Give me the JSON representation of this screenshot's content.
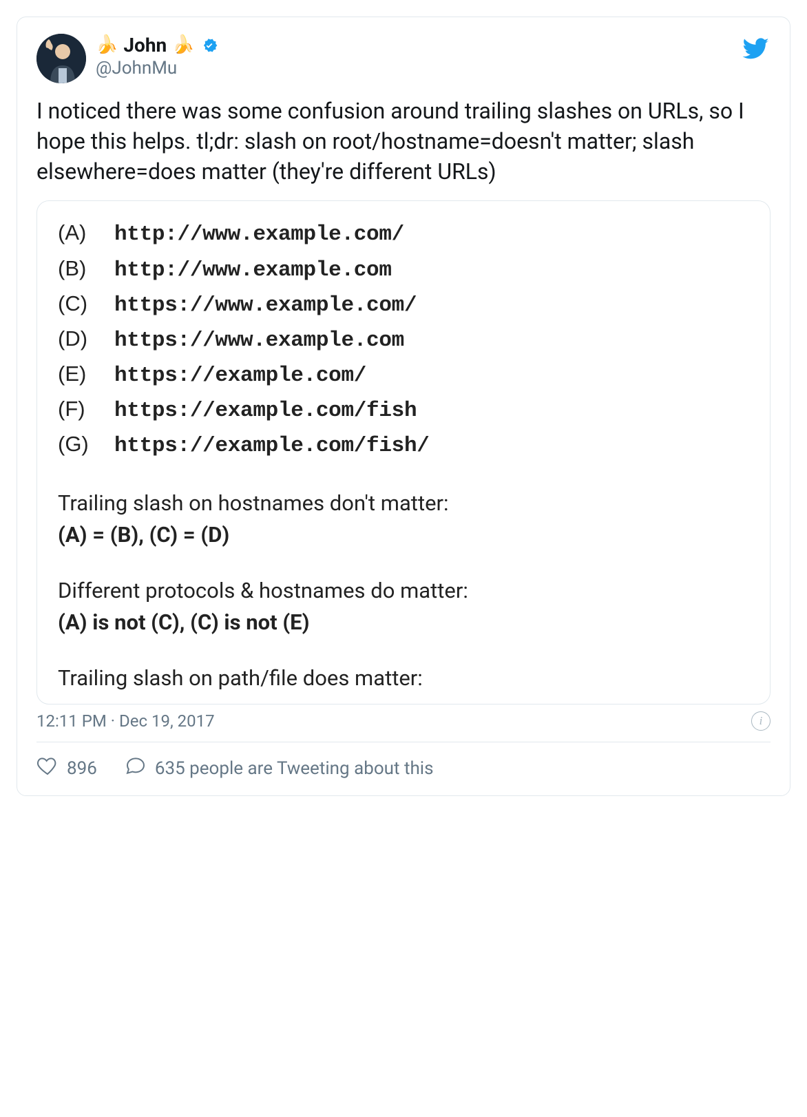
{
  "author": {
    "emoji_left": "🍌",
    "display_name": "John",
    "emoji_right": "🍌",
    "handle": "@JohnMu"
  },
  "tweet_text": "I noticed there was some confusion around trailing slashes on URLs, so I hope this helps. tl;dr: slash on root/hostname=doesn't matter; slash elsewhere=does matter (they're different URLs)",
  "urls": [
    {
      "label": "(A)",
      "value": "http://www.example.com/"
    },
    {
      "label": "(B)",
      "value": "http://www.example.com"
    },
    {
      "label": "(C)",
      "value": "https://www.example.com/"
    },
    {
      "label": "(D)",
      "value": "https://www.example.com"
    },
    {
      "label": "(E)",
      "value": "https://example.com/"
    },
    {
      "label": "(F)",
      "value": "https://example.com/fish"
    },
    {
      "label": "(G)",
      "value": "https://example.com/fish/"
    }
  ],
  "rules": [
    {
      "line1": "Trailing slash on hostnames don't matter:",
      "line2": "(A) = (B), (C) = (D)"
    },
    {
      "line1": "Different protocols & hostnames do matter:",
      "line2": "(A) is not (C), (C) is not (E)"
    },
    {
      "line1": "Trailing slash on path/file does matter:",
      "line2": ""
    }
  ],
  "timestamp": "12:11 PM · Dec 19, 2017",
  "likes": "896",
  "replies_text": "635 people are Tweeting about this"
}
